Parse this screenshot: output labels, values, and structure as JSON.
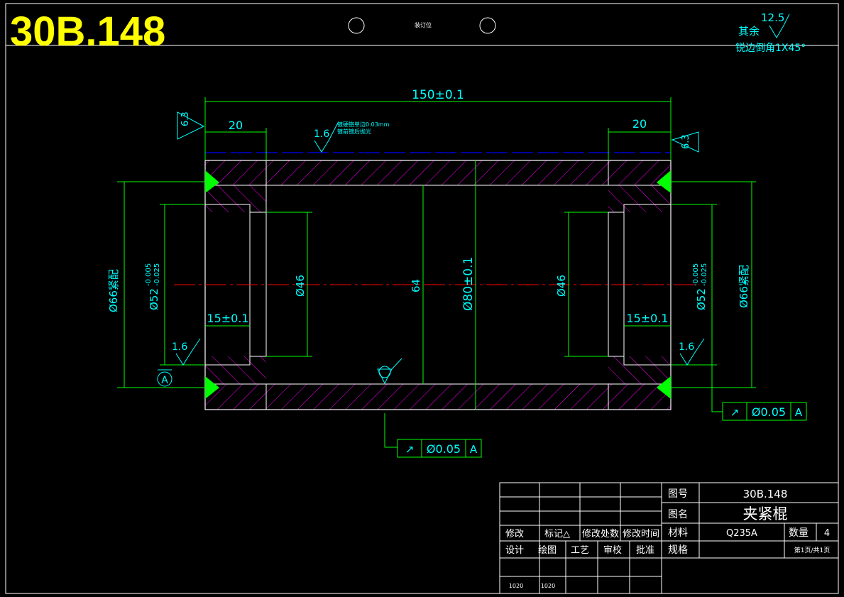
{
  "drawing_number_large": "30B.148",
  "binding_label": "装订位",
  "surface_note": {
    "prefix": "其余",
    "roughness": "12.5",
    "edge_note": "锐边倒角1X45°"
  },
  "dimensions": {
    "overall_length": "150±0.1",
    "left_step": "20",
    "right_step": "20",
    "left_roughness_end": "6.3",
    "right_roughness_end": "6.3",
    "top_roughness": "1.6",
    "top_note_line1": "镀硬铬单边0.03mm",
    "top_note_line2": "镀前镀后抛光",
    "left_outer_dia": "Ø66紧配",
    "right_outer_dia": "Ø66紧配",
    "left_bore_dia": "Ø52",
    "left_bore_tol_upper": "-0.005",
    "left_bore_tol_lower": "-0.025",
    "right_bore_dia": "Ø52",
    "right_bore_tol_upper": "-0.005",
    "right_bore_tol_lower": "-0.025",
    "left_inner_dia": "Ø46",
    "right_inner_dia": "Ø46",
    "inner_span": "64",
    "main_dia": "Ø80±0.1",
    "left_counterbore_depth": "15±0.1",
    "right_counterbore_depth": "15±0.1",
    "left_roughness_bore": "1.6",
    "right_roughness_bore": "1.6",
    "datum_label": "A"
  },
  "tolerance_frames": [
    {
      "symbol": "↗",
      "value": "Ø0.05",
      "datum": "A"
    },
    {
      "symbol": "↗",
      "value": "Ø0.05",
      "datum": "A"
    }
  ],
  "title_block": {
    "drawing_no_label": "图号",
    "drawing_no": "30B.148",
    "name_label": "图名",
    "name": "夹紧棍",
    "material_label": "材料",
    "material": "Q235A",
    "quantity_label": "数量",
    "quantity": "4",
    "spec_label": "规格",
    "page_info": "第1页/共1页",
    "revision_headers": [
      "修改",
      "标记△",
      "修改处数",
      "修改时间"
    ],
    "role_headers": [
      "设计",
      "绘图",
      "工艺",
      "审校",
      "批准"
    ],
    "dates": [
      "1020",
      "1020"
    ]
  },
  "colors": {
    "outline": "#ffffff",
    "dimension": "#00ff00",
    "text": "#00ffff",
    "hatch": "#ff00ff",
    "centerline": "#ff0000",
    "hidden": "#0000ff",
    "big_title": "#ffff00",
    "datum_triangle": "#00ff00"
  }
}
